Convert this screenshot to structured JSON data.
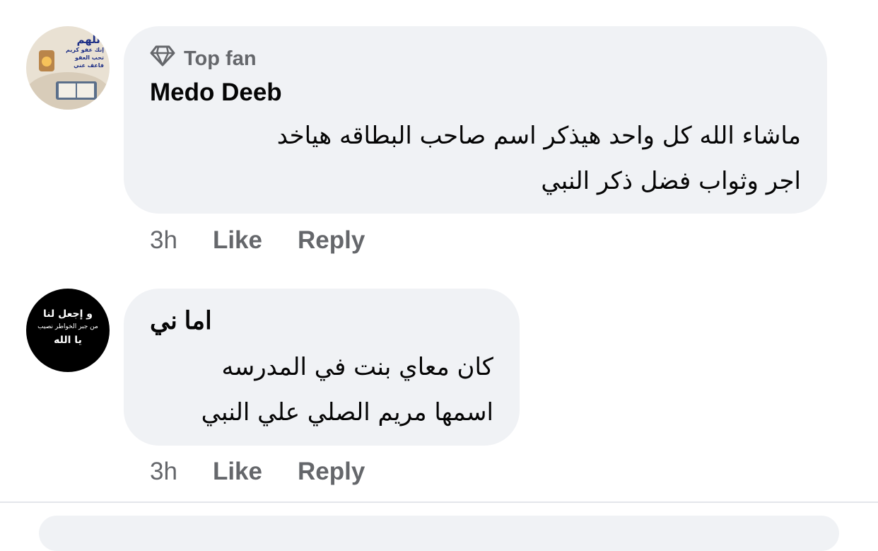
{
  "comments": [
    {
      "badge_label": "Top fan",
      "badge_icon": "diamond-icon",
      "author": "Medo Deeb",
      "avatar_text": [
        "اللهم",
        "إنك عفو كريم",
        "تحب العفو",
        "فاعف عني"
      ],
      "lines": [
        "ماشاء الله كل واحد هيذكر اسم صاحب البطاقه هياخد",
        "اجر وثواب فضل ذكر النبي"
      ],
      "time": "3h",
      "like_label": "Like",
      "reply_label": "Reply"
    },
    {
      "author": "اما ني",
      "avatar_text": [
        "و إجعل لنا",
        "من جبر الخواطر نصيب",
        "يا الله"
      ],
      "lines": [
        "كان معاي بنت في المدرسه",
        "اسمها مريم الصلي علي النبي"
      ],
      "time": "3h",
      "like_label": "Like",
      "reply_label": "Reply"
    }
  ],
  "colors": {
    "bubble": "#f0f2f5",
    "secondary_text": "#65676b",
    "primary_text": "#050505"
  }
}
